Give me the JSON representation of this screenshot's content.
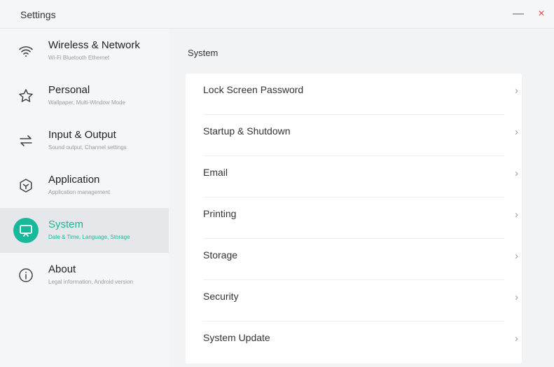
{
  "window": {
    "title": "Settings",
    "minimize_glyph": "—",
    "close_glyph": "×"
  },
  "colors": {
    "accent": "#19b89a",
    "close": "#e8433d",
    "sidebar_bg": "#f5f6f8",
    "active_bg": "#e6e7ea",
    "card_bg": "#ffffff"
  },
  "sidebar": {
    "items": [
      {
        "label": "Wireless & Network",
        "sub": "Wi-Fi Bluetooth Ethernet",
        "icon": "wifi-icon",
        "active": false
      },
      {
        "label": "Personal",
        "sub": "Wallpaper, Multi-Window Mode",
        "icon": "star-icon",
        "active": false
      },
      {
        "label": "Input & Output",
        "sub": "Sound output, Channel settings",
        "icon": "swap-arrows-icon",
        "active": false
      },
      {
        "label": "Application",
        "sub": "Application management",
        "icon": "hexagon-icon",
        "active": false
      },
      {
        "label": "System",
        "sub": "Date & Time, Language, Storage",
        "icon": "monitor-icon",
        "active": true
      },
      {
        "label": "About",
        "sub": "Legal information, Android version",
        "icon": "info-icon",
        "active": false
      }
    ]
  },
  "main": {
    "section_title": "System",
    "rows": [
      {
        "label": "Lock Screen Password",
        "chevron": "›"
      },
      {
        "label": "Startup & Shutdown",
        "chevron": "›"
      },
      {
        "label": "Email",
        "chevron": "›"
      },
      {
        "label": "Printing",
        "chevron": "›"
      },
      {
        "label": "Storage",
        "chevron": "›"
      },
      {
        "label": "Security",
        "chevron": "›"
      },
      {
        "label": "System Update",
        "chevron": "›"
      }
    ]
  }
}
